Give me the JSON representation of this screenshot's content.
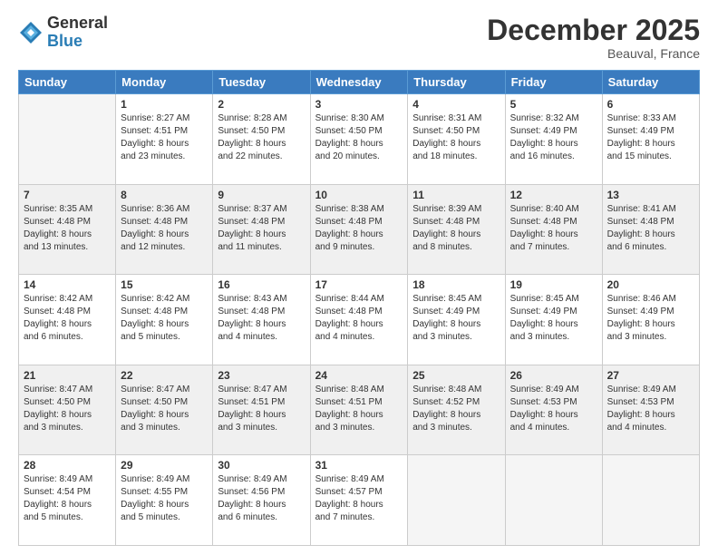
{
  "header": {
    "logo_general": "General",
    "logo_blue": "Blue",
    "month": "December 2025",
    "location": "Beauval, France"
  },
  "days_of_week": [
    "Sunday",
    "Monday",
    "Tuesday",
    "Wednesday",
    "Thursday",
    "Friday",
    "Saturday"
  ],
  "weeks": [
    {
      "shaded": false,
      "days": [
        {
          "num": "",
          "info": ""
        },
        {
          "num": "1",
          "info": "Sunrise: 8:27 AM\nSunset: 4:51 PM\nDaylight: 8 hours\nand 23 minutes."
        },
        {
          "num": "2",
          "info": "Sunrise: 8:28 AM\nSunset: 4:50 PM\nDaylight: 8 hours\nand 22 minutes."
        },
        {
          "num": "3",
          "info": "Sunrise: 8:30 AM\nSunset: 4:50 PM\nDaylight: 8 hours\nand 20 minutes."
        },
        {
          "num": "4",
          "info": "Sunrise: 8:31 AM\nSunset: 4:50 PM\nDaylight: 8 hours\nand 18 minutes."
        },
        {
          "num": "5",
          "info": "Sunrise: 8:32 AM\nSunset: 4:49 PM\nDaylight: 8 hours\nand 16 minutes."
        },
        {
          "num": "6",
          "info": "Sunrise: 8:33 AM\nSunset: 4:49 PM\nDaylight: 8 hours\nand 15 minutes."
        }
      ]
    },
    {
      "shaded": true,
      "days": [
        {
          "num": "7",
          "info": "Sunrise: 8:35 AM\nSunset: 4:48 PM\nDaylight: 8 hours\nand 13 minutes."
        },
        {
          "num": "8",
          "info": "Sunrise: 8:36 AM\nSunset: 4:48 PM\nDaylight: 8 hours\nand 12 minutes."
        },
        {
          "num": "9",
          "info": "Sunrise: 8:37 AM\nSunset: 4:48 PM\nDaylight: 8 hours\nand 11 minutes."
        },
        {
          "num": "10",
          "info": "Sunrise: 8:38 AM\nSunset: 4:48 PM\nDaylight: 8 hours\nand 9 minutes."
        },
        {
          "num": "11",
          "info": "Sunrise: 8:39 AM\nSunset: 4:48 PM\nDaylight: 8 hours\nand 8 minutes."
        },
        {
          "num": "12",
          "info": "Sunrise: 8:40 AM\nSunset: 4:48 PM\nDaylight: 8 hours\nand 7 minutes."
        },
        {
          "num": "13",
          "info": "Sunrise: 8:41 AM\nSunset: 4:48 PM\nDaylight: 8 hours\nand 6 minutes."
        }
      ]
    },
    {
      "shaded": false,
      "days": [
        {
          "num": "14",
          "info": "Sunrise: 8:42 AM\nSunset: 4:48 PM\nDaylight: 8 hours\nand 6 minutes."
        },
        {
          "num": "15",
          "info": "Sunrise: 8:42 AM\nSunset: 4:48 PM\nDaylight: 8 hours\nand 5 minutes."
        },
        {
          "num": "16",
          "info": "Sunrise: 8:43 AM\nSunset: 4:48 PM\nDaylight: 8 hours\nand 4 minutes."
        },
        {
          "num": "17",
          "info": "Sunrise: 8:44 AM\nSunset: 4:48 PM\nDaylight: 8 hours\nand 4 minutes."
        },
        {
          "num": "18",
          "info": "Sunrise: 8:45 AM\nSunset: 4:49 PM\nDaylight: 8 hours\nand 3 minutes."
        },
        {
          "num": "19",
          "info": "Sunrise: 8:45 AM\nSunset: 4:49 PM\nDaylight: 8 hours\nand 3 minutes."
        },
        {
          "num": "20",
          "info": "Sunrise: 8:46 AM\nSunset: 4:49 PM\nDaylight: 8 hours\nand 3 minutes."
        }
      ]
    },
    {
      "shaded": true,
      "days": [
        {
          "num": "21",
          "info": "Sunrise: 8:47 AM\nSunset: 4:50 PM\nDaylight: 8 hours\nand 3 minutes."
        },
        {
          "num": "22",
          "info": "Sunrise: 8:47 AM\nSunset: 4:50 PM\nDaylight: 8 hours\nand 3 minutes."
        },
        {
          "num": "23",
          "info": "Sunrise: 8:47 AM\nSunset: 4:51 PM\nDaylight: 8 hours\nand 3 minutes."
        },
        {
          "num": "24",
          "info": "Sunrise: 8:48 AM\nSunset: 4:51 PM\nDaylight: 8 hours\nand 3 minutes."
        },
        {
          "num": "25",
          "info": "Sunrise: 8:48 AM\nSunset: 4:52 PM\nDaylight: 8 hours\nand 3 minutes."
        },
        {
          "num": "26",
          "info": "Sunrise: 8:49 AM\nSunset: 4:53 PM\nDaylight: 8 hours\nand 4 minutes."
        },
        {
          "num": "27",
          "info": "Sunrise: 8:49 AM\nSunset: 4:53 PM\nDaylight: 8 hours\nand 4 minutes."
        }
      ]
    },
    {
      "shaded": false,
      "days": [
        {
          "num": "28",
          "info": "Sunrise: 8:49 AM\nSunset: 4:54 PM\nDaylight: 8 hours\nand 5 minutes."
        },
        {
          "num": "29",
          "info": "Sunrise: 8:49 AM\nSunset: 4:55 PM\nDaylight: 8 hours\nand 5 minutes."
        },
        {
          "num": "30",
          "info": "Sunrise: 8:49 AM\nSunset: 4:56 PM\nDaylight: 8 hours\nand 6 minutes."
        },
        {
          "num": "31",
          "info": "Sunrise: 8:49 AM\nSunset: 4:57 PM\nDaylight: 8 hours\nand 7 minutes."
        },
        {
          "num": "",
          "info": ""
        },
        {
          "num": "",
          "info": ""
        },
        {
          "num": "",
          "info": ""
        }
      ]
    }
  ]
}
